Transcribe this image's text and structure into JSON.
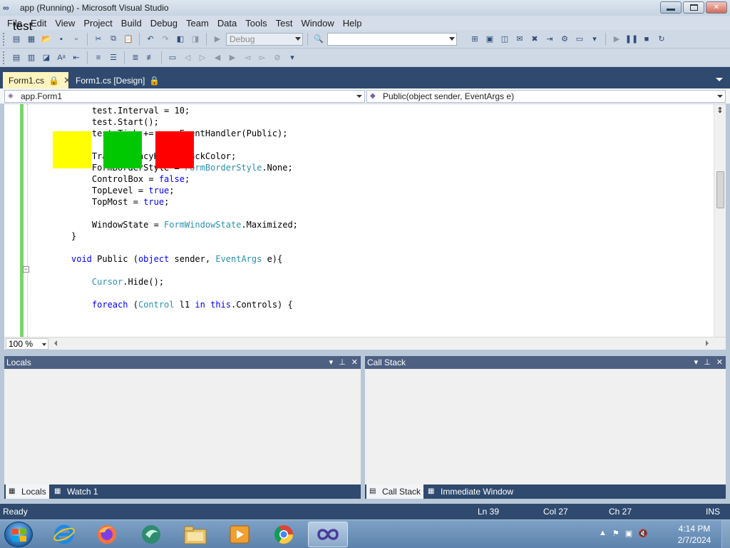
{
  "window": {
    "title": "app (Running) - Microsoft Visual Studio"
  },
  "overlay": {
    "label": "test"
  },
  "menu": [
    "File",
    "Edit",
    "View",
    "Project",
    "Build",
    "Debug",
    "Team",
    "Data",
    "Tools",
    "Test",
    "Window",
    "Help"
  ],
  "toolbar": {
    "config_value": "Debug",
    "find_value": ""
  },
  "tabs": [
    {
      "label": "Form1.cs"
    },
    {
      "label": "Form1.cs [Design]"
    }
  ],
  "nav": {
    "class_combo": "app.Form1",
    "member_combo": "Public(object sender, EventArgs e)"
  },
  "editor": {
    "zoom": "100 %"
  },
  "colors": {
    "yellow": "#ffff00",
    "green": "#00c800",
    "red": "#ff0000",
    "margin": "#7cd36d"
  },
  "panels": {
    "left": {
      "title": "Locals",
      "tabs": [
        "Locals",
        "Watch 1"
      ]
    },
    "right": {
      "title": "Call Stack",
      "tabs": [
        "Call Stack",
        "Immediate Window"
      ]
    }
  },
  "status": {
    "state": "Ready",
    "ln": "Ln 39",
    "col": "Col 27",
    "ch": "Ch 27",
    "mode": "INS"
  },
  "clock": {
    "time": "4:14 PM",
    "date": "2/7/2024"
  }
}
